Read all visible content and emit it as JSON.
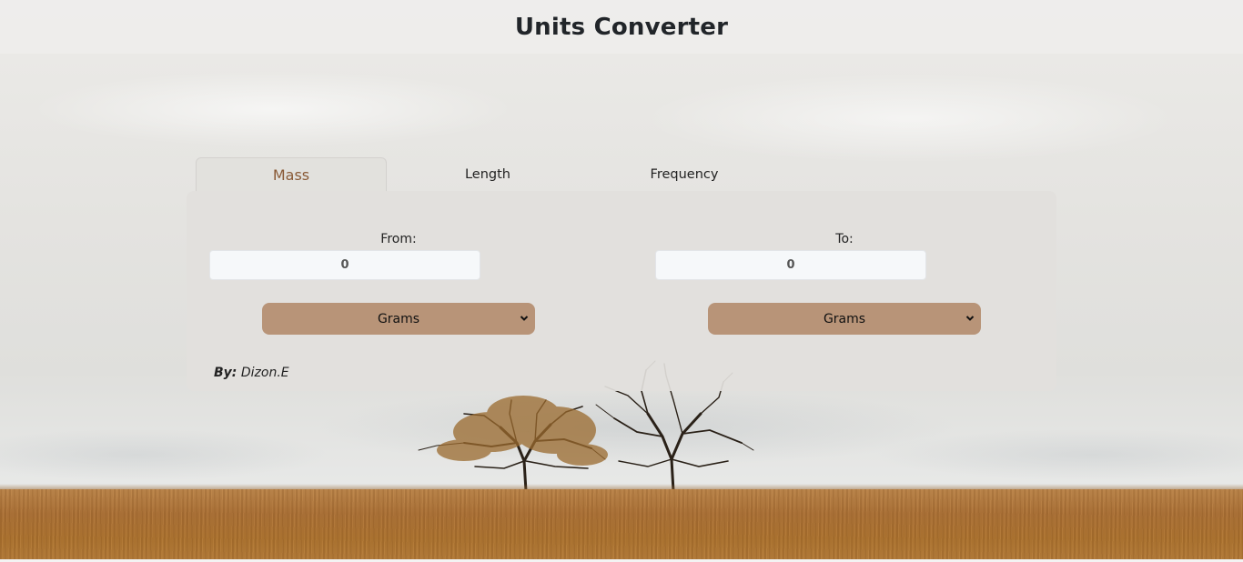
{
  "app": {
    "title": "Units Converter"
  },
  "tabs": [
    {
      "label": "Mass",
      "active": true
    },
    {
      "label": "Length",
      "active": false
    },
    {
      "label": "Frequency",
      "active": false
    }
  ],
  "converter": {
    "from": {
      "label": "From:",
      "value": "0",
      "unit": "Grams"
    },
    "to": {
      "label": "To:",
      "value": "0",
      "unit": "Grams"
    }
  },
  "footer": {
    "by_label": "By:",
    "author": "Dizon.E"
  },
  "colors": {
    "accent_tab_text": "#8a5a36",
    "select_background": "#b89478",
    "input_background": "#f6f8fa"
  },
  "icons": {
    "select_chevron": "chevron-down-icon"
  }
}
